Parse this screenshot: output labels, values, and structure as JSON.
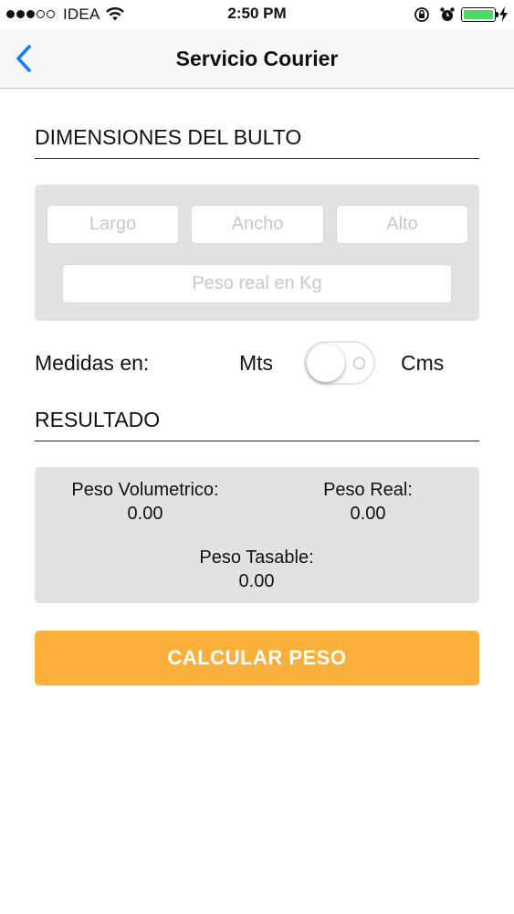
{
  "status_bar": {
    "carrier": "IDEA",
    "time": "2:50 PM",
    "signal_bars": 3,
    "signal_total": 5,
    "battery_level": 1.0,
    "battery_color": "#4cd964",
    "icons": [
      "wifi-icon",
      "orientation-lock-icon",
      "alarm-icon",
      "battery-icon",
      "charging-icon"
    ]
  },
  "nav": {
    "title": "Servicio Courier",
    "back_icon": "chevron-left-icon",
    "accent_color": "#157efb"
  },
  "dimensions": {
    "heading": "DIMENSIONES DEL BULTO",
    "largo": {
      "placeholder": "Largo",
      "value": ""
    },
    "ancho": {
      "placeholder": "Ancho",
      "value": ""
    },
    "alto": {
      "placeholder": "Alto",
      "value": ""
    },
    "peso_real": {
      "placeholder": "Peso real en Kg",
      "value": ""
    }
  },
  "units": {
    "label": "Medidas en:",
    "left_option": "Mts",
    "right_option": "Cms",
    "toggle_on": false
  },
  "result": {
    "heading": "RESULTADO",
    "peso_volumetrico_label": "Peso Volumetrico:",
    "peso_volumetrico_value": "0.00",
    "peso_real_label": "Peso Real:",
    "peso_real_value": "0.00",
    "peso_tasable_label": "Peso Tasable:",
    "peso_tasable_value": "0.00"
  },
  "calculate_button": {
    "label": "CALCULAR PESO",
    "color": "#fbb03b"
  }
}
